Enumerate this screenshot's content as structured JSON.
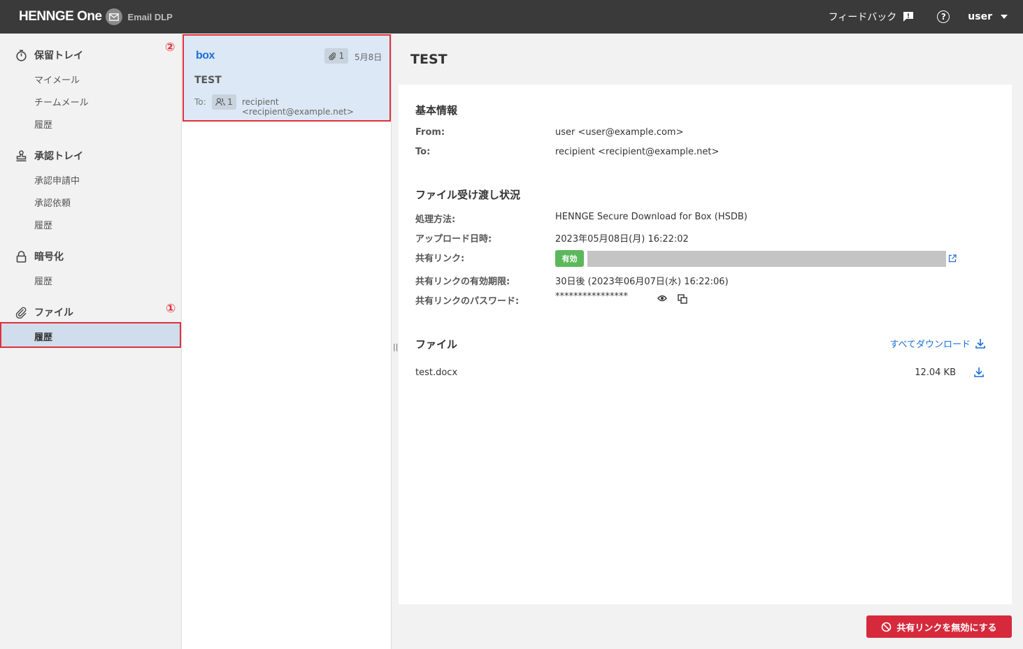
{
  "topbar": {
    "brand": "HENNGE One",
    "product": "Email DLP",
    "feedback": "フィードバック",
    "help": "?",
    "user": "user"
  },
  "sidebar": {
    "sections": [
      {
        "title": "保留トレイ",
        "icon": "timer-icon",
        "items": [
          "マイメール",
          "チームメール",
          "履歴"
        ]
      },
      {
        "title": "承認トレイ",
        "icon": "stamp-icon",
        "items": [
          "承認申請中",
          "承認依頼",
          "履歴"
        ]
      },
      {
        "title": "暗号化",
        "icon": "lock-icon",
        "items": [
          "履歴"
        ]
      },
      {
        "title": "ファイル",
        "icon": "paperclip-icon",
        "items": [
          "履歴"
        ]
      }
    ],
    "marker1": "①"
  },
  "list": {
    "marker2": "②",
    "card": {
      "logo": "box",
      "attachments": "1",
      "date": "5月8日",
      "subject": "TEST",
      "to_label": "To:",
      "recipient_count": "1",
      "recipient": "recipient <recipient@example.net>"
    }
  },
  "detail": {
    "title": "TEST",
    "basic": {
      "heading": "基本情報",
      "from_label": "From:",
      "from": "user <user@example.com>",
      "to_label": "To:",
      "to": "recipient <recipient@example.net>"
    },
    "transfer": {
      "heading": "ファイル受け渡し状況",
      "method_label": "処理方法:",
      "method": "HENNGE Secure Download for Box (HSDB)",
      "upload_label": "アップロード日時:",
      "upload": "2023年05月08日(月) 16:22:02",
      "link_label": "共有リンク:",
      "link_status": "有効",
      "expiry_label": "共有リンクの有効期限:",
      "expiry": "30日後 (2023年06月07日(水) 16:22:06)",
      "password_label": "共有リンクのパスワード:",
      "password": "****************"
    },
    "files": {
      "heading": "ファイル",
      "download_all": "すべてダウンロード",
      "items": [
        {
          "name": "test.docx",
          "size": "12.04 KB"
        }
      ]
    },
    "disable_button": "共有リンクを無効にする"
  },
  "colors": {
    "accent": "#1a6fd6",
    "danger": "#d62a3c",
    "valid": "#5cb85c",
    "selected": "#cfdded"
  }
}
